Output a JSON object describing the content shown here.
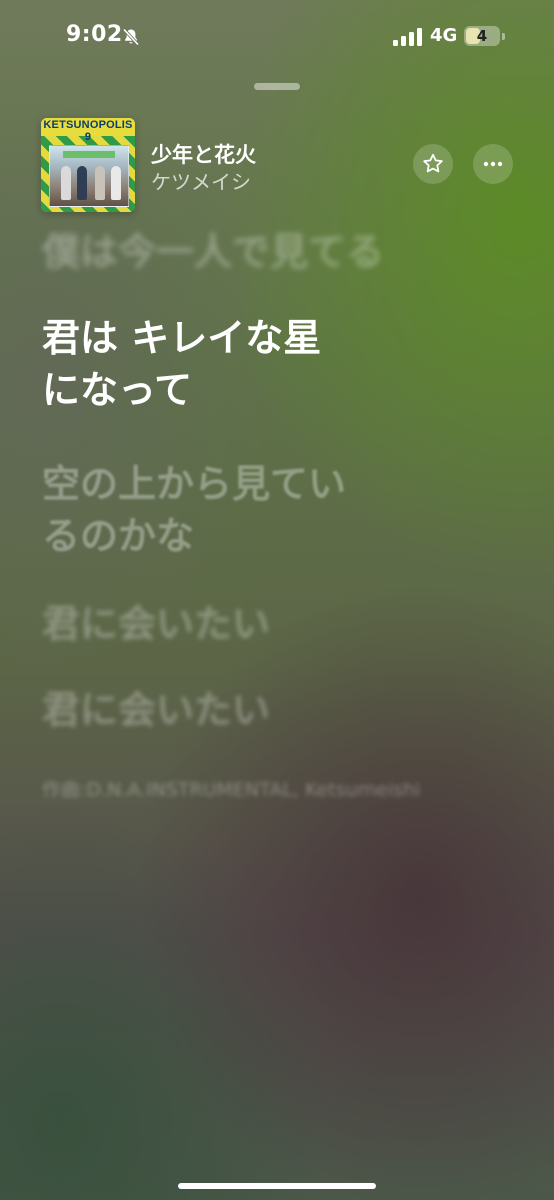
{
  "status_bar": {
    "time": "9:02",
    "silent_icon": "bell-slash-icon",
    "signal_icon": "cellular-signal-icon",
    "network": "4G",
    "battery_level": "4",
    "battery_fraction": 0.04
  },
  "album": {
    "art_text": "KETSUNOPOLIS 9"
  },
  "track": {
    "title": "少年と花火",
    "artist": "ケツメイシ"
  },
  "actions": {
    "favorite_icon": "star-icon",
    "more_icon": "ellipsis-icon"
  },
  "lyrics": {
    "past": "僕は今一人で見てる",
    "current": "君は キレイな星になって",
    "upcoming": [
      "空の上から見ているのかな",
      "君に会いたい",
      "君に会いたい"
    ],
    "credits": "作曲:D.N.A.INSTRUMENTAL, Ketsumeishi"
  },
  "colors": {
    "background_green": "#5c8c24",
    "text_primary": "#ffffff"
  }
}
